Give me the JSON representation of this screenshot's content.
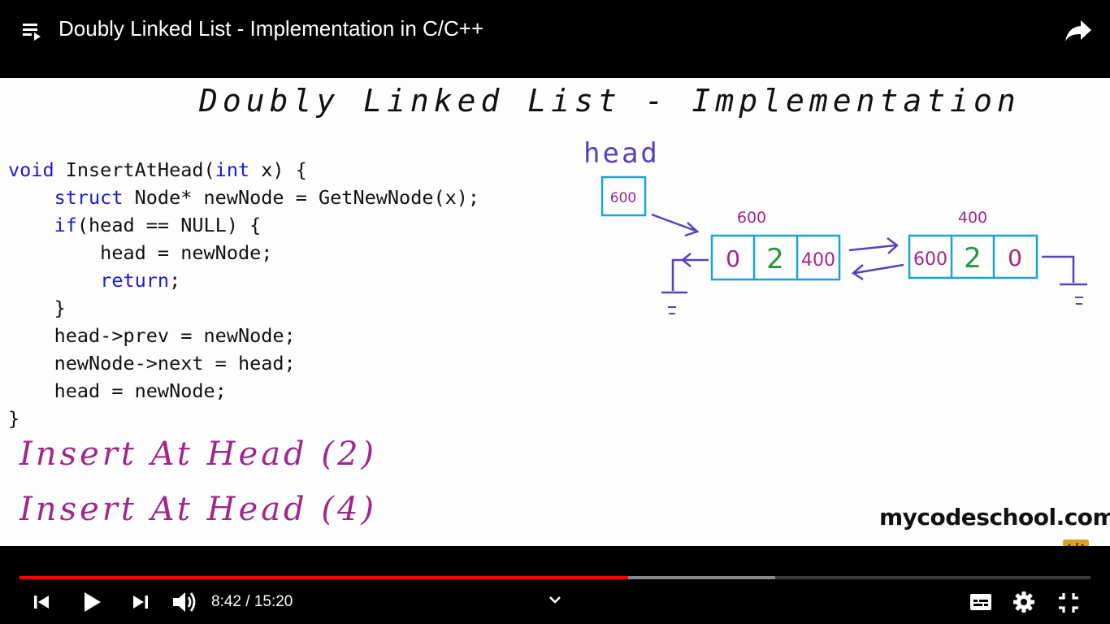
{
  "header": {
    "title": "Doubly Linked List - Implementation in C/C++"
  },
  "slide": {
    "title": "Doubly Linked List - Implementation",
    "code_lines": [
      "void InsertAtHead(int x) {",
      "    struct Node* newNode = GetNewNode(x);",
      "    if(head == NULL) {",
      "        head = newNode;",
      "        return;",
      "    }",
      "    head->prev = newNode;",
      "    newNode->next = head;",
      "    head = newNode;",
      "}"
    ],
    "handwritten": [
      "Insert At Head (2)",
      "Insert At Head (4)"
    ],
    "watermark": "mycodeschool.com",
    "diagram": {
      "head_label": "head",
      "head_value": "600",
      "node1": {
        "address": "600",
        "prev": "0",
        "data": "2",
        "next": "400"
      },
      "node2": {
        "address": "400",
        "prev": "600",
        "data": "2",
        "next": "0"
      }
    }
  },
  "player": {
    "time": "8:42 / 15:20",
    "played_fraction": 0.568,
    "buffered_fraction": 0.7055
  },
  "colors": {
    "played": "#ff0000",
    "buffered": "#8a8a8a",
    "keyword": "#1a1ad9",
    "handwriting": "#a0278a",
    "diagram_blue": "#1aa3d6",
    "diagram_purple": "#5a3fc0",
    "diagram_green": "#1e9a3c"
  }
}
